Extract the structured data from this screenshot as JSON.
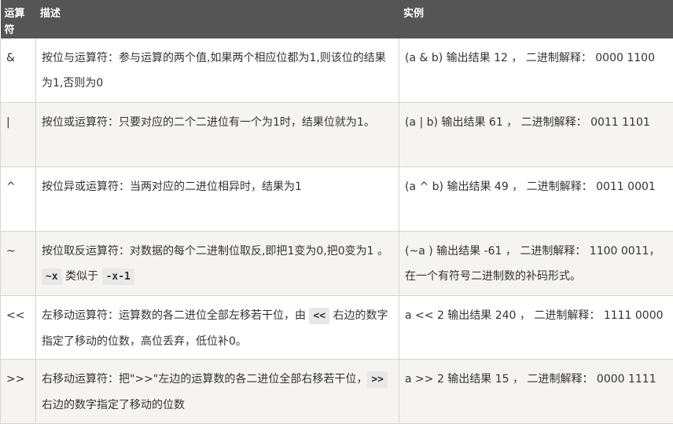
{
  "headers": {
    "operator": "运算符",
    "description": "描述",
    "example": "实例"
  },
  "rows": [
    {
      "operator": "&",
      "description": "按位与运算符：参与运算的两个值,如果两个相应位都为1,则该位的结果为1,否则为0",
      "example": "(a & b) 输出结果 12 ， 二进制解释： 0000 1100"
    },
    {
      "operator": "|",
      "description": "按位或运算符：只要对应的二个二进位有一个为1时，结果位就为1。",
      "example": "(a | b) 输出结果 61 ， 二进制解释： 0011 1101"
    },
    {
      "operator": "^",
      "description": "按位异或运算符：当两对应的二进位相异时，结果为1",
      "example": "(a ^ b) 输出结果 49 ， 二进制解释： 0011 0001"
    },
    {
      "operator": "~",
      "description_parts": [
        "按位取反运算符：对数据的每个二进制位取反,即把1变为0,把0变为1 。",
        "~x",
        " 类似于 ",
        "-x-1"
      ],
      "example": "(~a ) 输出结果 -61 ， 二进制解释： 1100 0011，在一个有符号二进制数的补码形式。"
    },
    {
      "operator": "<<",
      "description_parts": [
        "左移动运算符：运算数的各二进位全部左移若干位，由 ",
        "<<",
        " 右边的数字指定了移动的位数，高位丢弃，低位补0。"
      ],
      "example": "a << 2 输出结果 240 ， 二进制解释： 1111 0000"
    },
    {
      "operator": ">>",
      "description_parts": [
        "右移动运算符：把\">>\"左边的运算数的各二进位全部右移若干位，",
        ">>",
        " 右边的数字指定了移动的位数"
      ],
      "example": "a >> 2 输出结果 15 ， 二进制解释： 0000 1111"
    }
  ]
}
